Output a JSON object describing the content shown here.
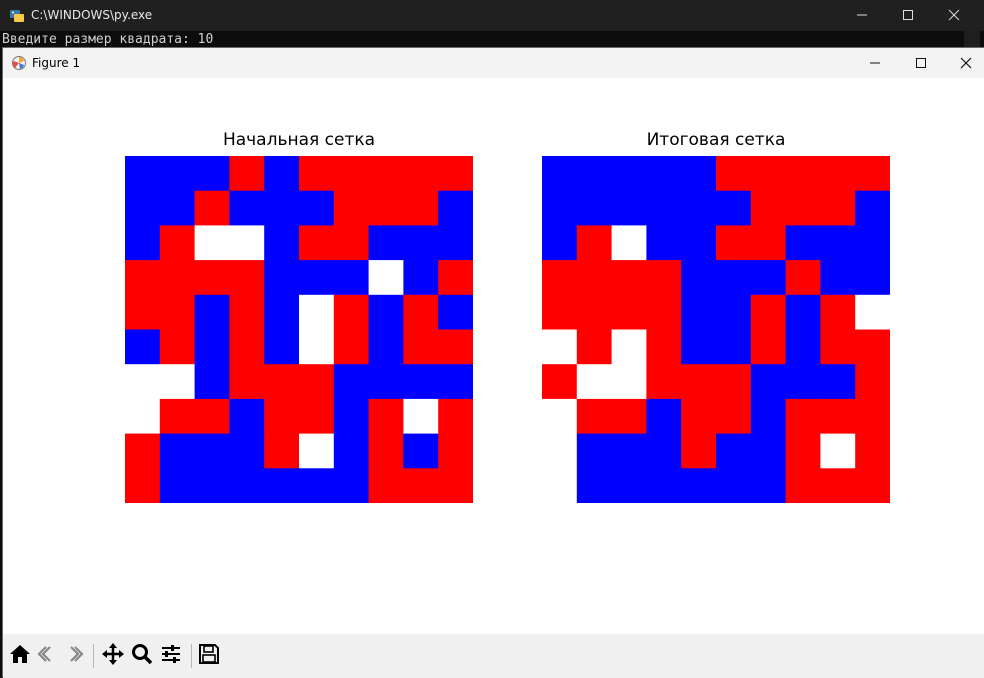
{
  "console": {
    "title": "C:\\WINDOWS\\py.exe",
    "prompt_line": "Введите размер квадрата: 10"
  },
  "figure": {
    "title": "Figure 1"
  },
  "plots": [
    {
      "title": "Начальная сетка",
      "rows": [
        "BBBRBRRRRR",
        "BBRBBBRRRB",
        "BRWWBRRBBB",
        "RRRRBBBWBR",
        "RRBRBWRBRB",
        "BRBRBWRBRR",
        "WWBRRRBBBB",
        "WRRBRRBRWR",
        "RBBBRWBRBR",
        "RBBBBBBRRR"
      ]
    },
    {
      "title": "Итоговая сетка",
      "rows": [
        "BBBBBRRRRR",
        "BBBBBBRRRB",
        "BRWBBRRBBB",
        "RRRRBBBRBB",
        "RRRRBBRBRW",
        "WRWRBBRBRR",
        "RWWRRRBBBR",
        "WRRBRRBRRR",
        "WBBBRBBRWR",
        "WBBBBBBRRR"
      ]
    }
  ],
  "colors": {
    "R": "#ff0000",
    "B": "#0000ff",
    "W": "#ffffff"
  },
  "toolbar": {
    "buttons": [
      "home-icon",
      "back-arrow-icon",
      "forward-arrow-icon",
      "pan-icon",
      "zoom-icon",
      "configure-subplots-icon",
      "save-icon"
    ]
  }
}
